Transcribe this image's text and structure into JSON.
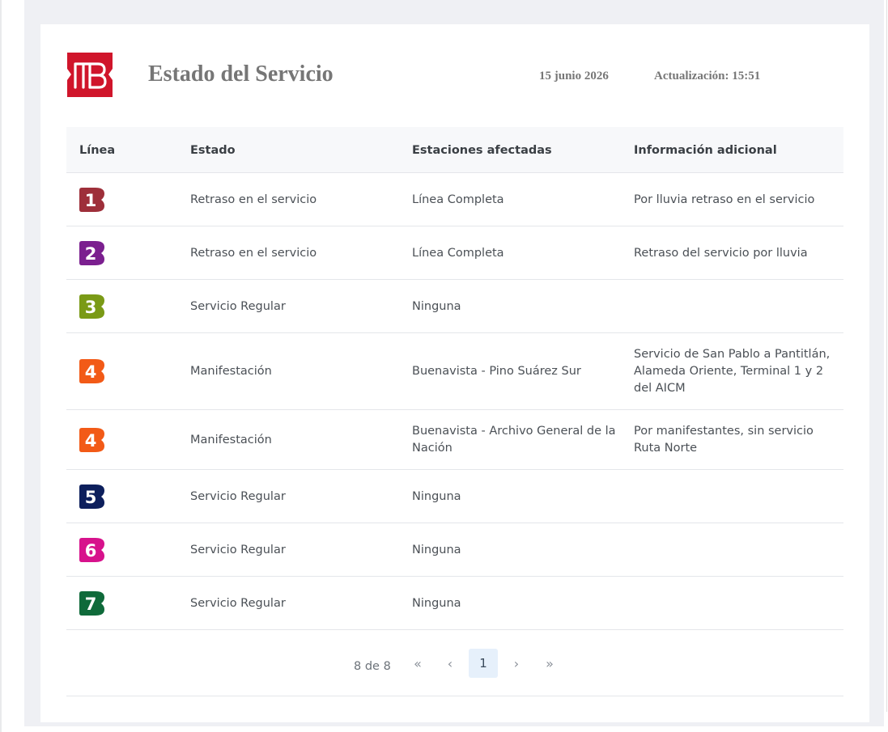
{
  "header": {
    "logo_label": "MB",
    "title": "Estado del Servicio",
    "date": "15 junio 2026",
    "updated": "Actualización: 15:51"
  },
  "table": {
    "columns": [
      "Línea",
      "Estado",
      "Estaciones afectadas",
      "Información adicional"
    ],
    "rows": [
      {
        "line": "1",
        "color": "#9e2f3a",
        "status": "Retraso en el servicio",
        "stations": "Línea Completa",
        "info": "Por lluvia retraso en el servicio"
      },
      {
        "line": "2",
        "color": "#7b1f8f",
        "status": "Retraso en el servicio",
        "stations": "Línea Completa",
        "info": "Retraso del servicio por lluvia"
      },
      {
        "line": "3",
        "color": "#7a9a16",
        "status": "Servicio Regular",
        "stations": "Ninguna",
        "info": ""
      },
      {
        "line": "4",
        "color": "#f25a17",
        "status": "Manifestación",
        "stations": "Buenavista - Pino Suárez Sur",
        "info": "Servicio de San Pablo a Pantitlán, Alameda Oriente, Terminal 1 y 2 del AICM"
      },
      {
        "line": "4",
        "color": "#f25a17",
        "status": "Manifestación",
        "stations": "Buenavista - Archivo General de la Nación",
        "info": "Por manifestantes, sin servicio Ruta Norte"
      },
      {
        "line": "5",
        "color": "#0d1f5c",
        "status": "Servicio Regular",
        "stations": "Ninguna",
        "info": ""
      },
      {
        "line": "6",
        "color": "#d7128c",
        "status": "Servicio Regular",
        "stations": "Ninguna",
        "info": ""
      },
      {
        "line": "7",
        "color": "#0f6a3a",
        "status": "Servicio Regular",
        "stations": "Ninguna",
        "info": ""
      }
    ]
  },
  "pagination": {
    "count": "8 de 8",
    "first_icon": "chevrons-left-icon",
    "prev_icon": "chevron-left-icon",
    "current_page": "1",
    "next_icon": "chevron-right-icon",
    "last_icon": "chevrons-right-icon"
  },
  "colors": {
    "brand_red": "#d0152b",
    "title_gray": "#767676",
    "current_page_bg": "#e6f0fb"
  }
}
